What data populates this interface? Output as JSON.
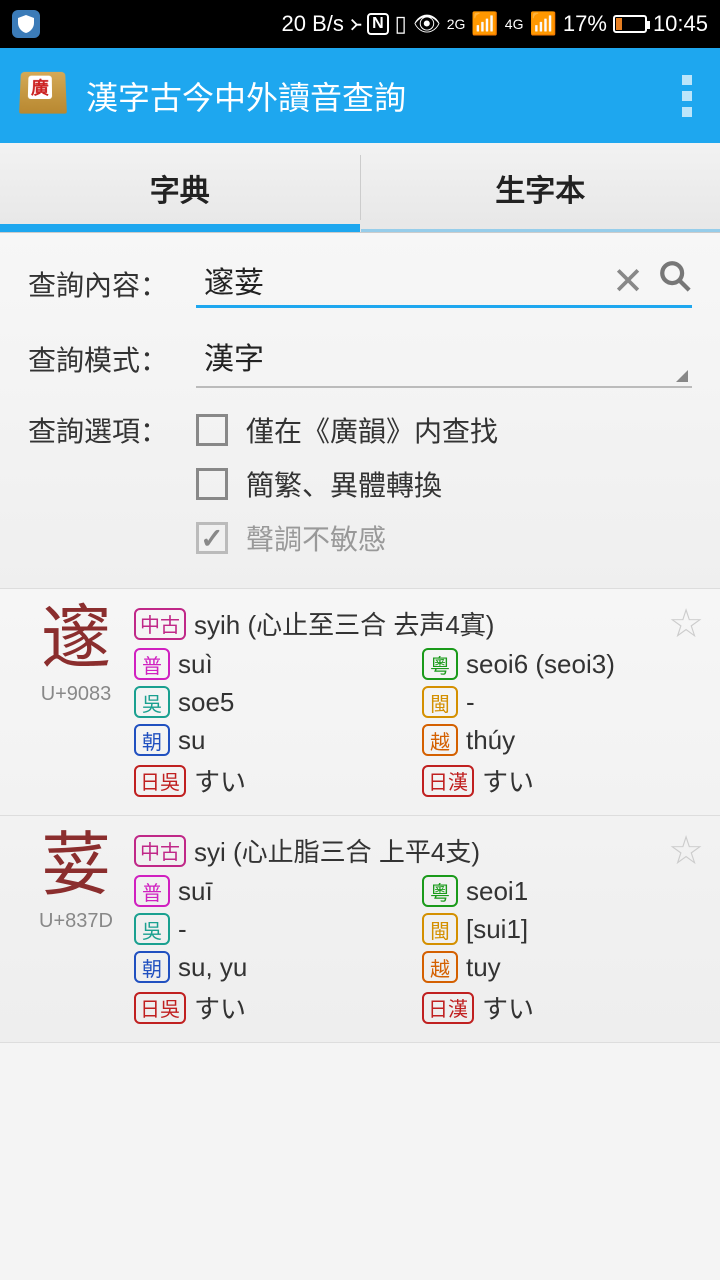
{
  "status": {
    "speed": "20 B/s",
    "battery": "17%",
    "time": "10:45",
    "net1": "2G",
    "net2": "4G"
  },
  "app": {
    "title": "漢字古今中外讀音查詢"
  },
  "tabs": {
    "dict": "字典",
    "vocab": "生字本"
  },
  "search": {
    "label_content": "查詢內容：",
    "value": "邃荽",
    "label_mode": "查詢模式：",
    "mode_value": "漢字",
    "label_options": "查詢選項：",
    "opt_gy": "僅在《廣韻》内查找",
    "opt_variant": "簡繁、異體轉換",
    "opt_tone": "聲調不敏感"
  },
  "tags": {
    "mc": "中古",
    "pu": "普",
    "yue": "粵",
    "wu": "吳",
    "min": "閩",
    "kor": "朝",
    "vie": "越",
    "jgo": "日吳",
    "jkan": "日漢"
  },
  "entries": [
    {
      "char": "邃",
      "ucode": "U+9083",
      "mc": "syih (心止至三合 去声4寘)",
      "pu": "suì",
      "yue": "seoi6 (seoi3)",
      "wu": "soe5",
      "min": "-",
      "kor": "su",
      "vie": "thúy",
      "jgo": "すい",
      "jkan": "すい"
    },
    {
      "char": "荽",
      "ucode": "U+837D",
      "mc": "syi (心止脂三合 上平4支)",
      "pu": "suī",
      "yue": "seoi1",
      "wu": "-",
      "min": "[sui1]",
      "kor": "su, yu",
      "vie": "tuy",
      "jgo": "すい",
      "jkan": "すい"
    }
  ]
}
